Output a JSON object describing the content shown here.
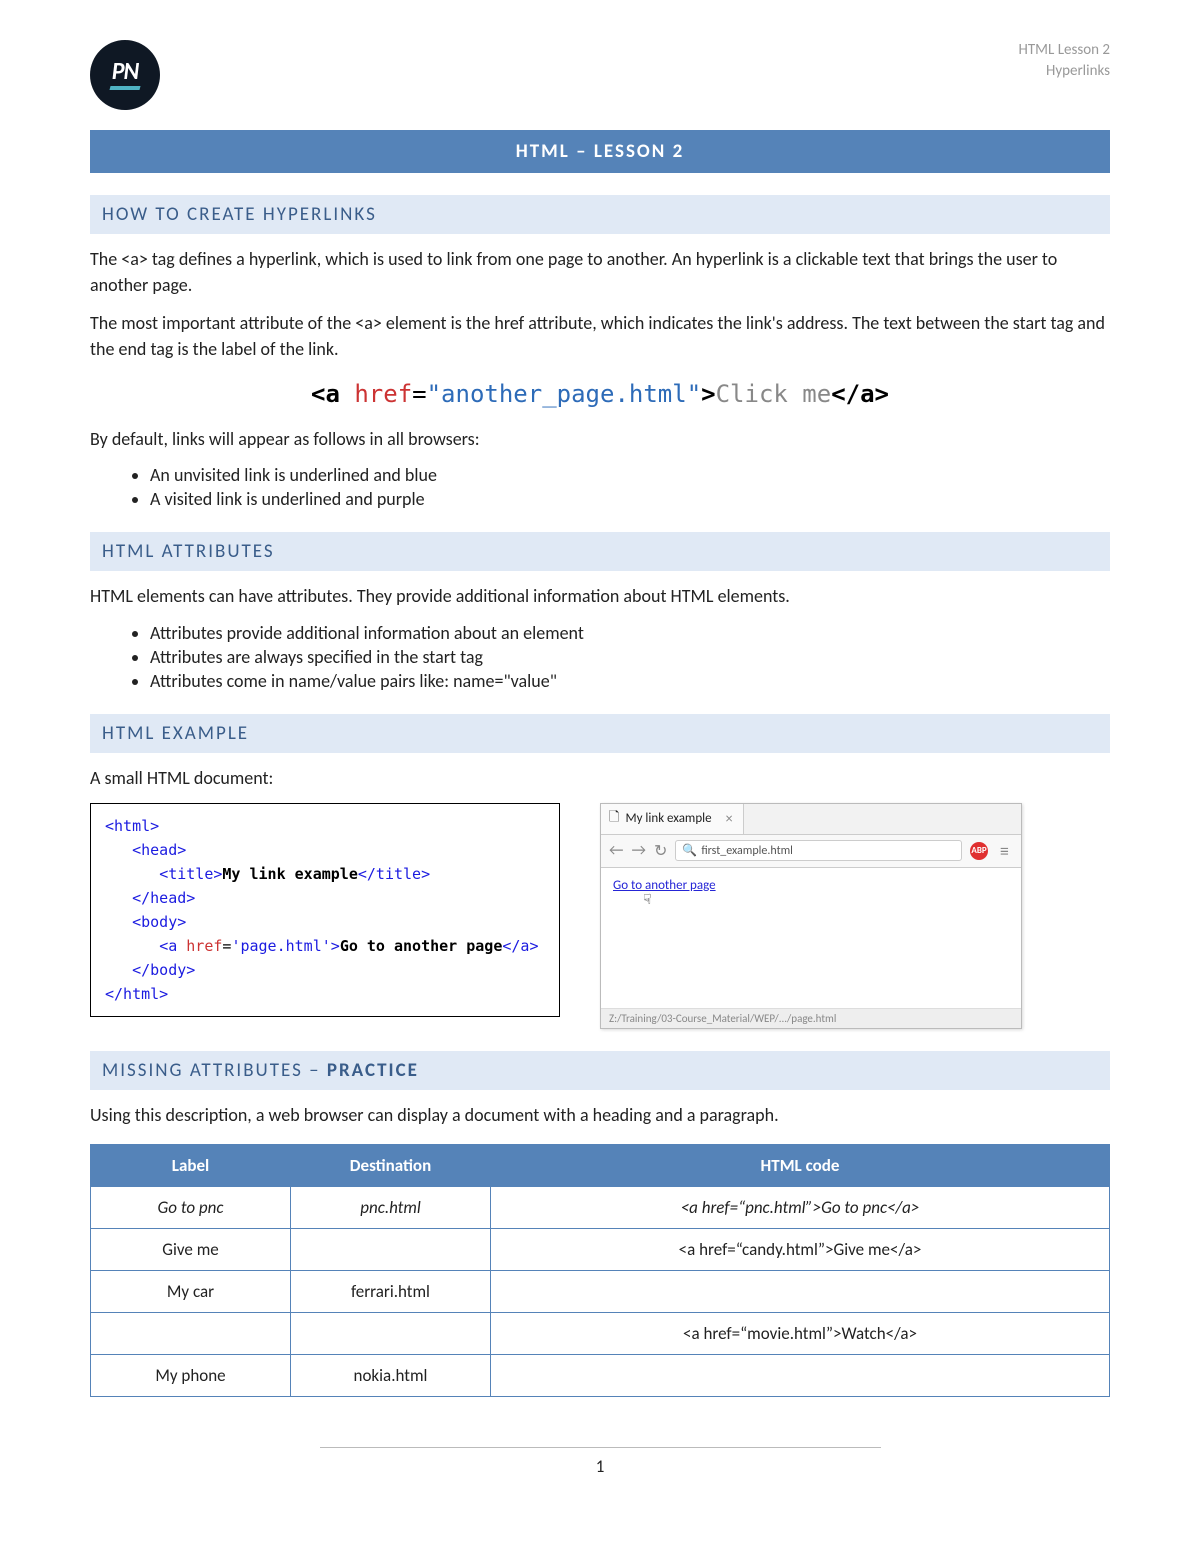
{
  "meta": {
    "line1": "HTML Lesson 2",
    "line2": "Hyperlinks"
  },
  "logo": {
    "text": "PN"
  },
  "title": "HTML – LESSON 2",
  "sections": {
    "hyperlinks_heading": "HOW TO CREATE HYPERLINKS",
    "hyperlinks_p1": "The <a> tag defines a hyperlink, which is used to link from one page to another. An hyperlink is a clickable text that brings the user to another page.",
    "hyperlinks_p2": "The most important attribute of the <a> element is the href attribute, which indicates the link's address. The text between the start tag and the end tag is the label of the link.",
    "code_hero": {
      "open_tag": "<a ",
      "attr": "href",
      "eq": "=",
      "val": "\"another_page.html\"",
      "close_open": ">",
      "text": "Click me",
      "close_tag": "</a>"
    },
    "hyperlinks_p3": "By default, links will appear as follows in all browsers:",
    "hyperlinks_bullets": [
      "An unvisited link is underlined and blue",
      "A visited link is underlined and purple"
    ],
    "attrs_heading": "HTML ATTRIBUTES",
    "attrs_p1": "HTML elements can have attributes. They provide additional information about HTML elements.",
    "attrs_bullets": [
      "Attributes provide additional information about an element",
      "Attributes are always specified in the start tag",
      "Attributes come in name/value pairs like: name=\"value\""
    ],
    "example_heading": "HTML EXAMPLE",
    "example_caption": "A small HTML document:",
    "code_box": "<html>\n   <head>\n      <title>My link example</title>\n   </head>\n   <body>\n      <a href='page.html'>Go to another page</a>\n   </body>\n</html>",
    "browser": {
      "tab_title": "My link example",
      "address": "first_example.html",
      "link_text": "Go to another page",
      "status": "Z:/Training/03-Course_Material/WEP/.../page.html",
      "ext_badge": "ABP"
    },
    "practice_heading_pre": "MISSING ATTRIBUTES – ",
    "practice_heading_bold": "PRACTICE",
    "practice_p": "Using this description, a web browser can display a document with a heading and a paragraph.",
    "table": {
      "headers": [
        "Label",
        "Destination",
        "HTML code"
      ],
      "rows": [
        {
          "label": "Go to pnc",
          "dest": "pnc.html",
          "code": "<a href=“pnc.html”>Go to pnc</a>",
          "italic": true
        },
        {
          "label": "Give me",
          "dest": "",
          "code": "<a href=“candy.html”>Give me</a>",
          "italic": false
        },
        {
          "label": "My car",
          "dest": "ferrari.html",
          "code": "",
          "italic": false
        },
        {
          "label": "",
          "dest": "",
          "code": "<a href=“movie.html”>Watch</a>",
          "italic": false
        },
        {
          "label": "My phone",
          "dest": "nokia.html",
          "code": "",
          "italic": false
        }
      ]
    }
  },
  "footer": {
    "page_number": "1"
  }
}
